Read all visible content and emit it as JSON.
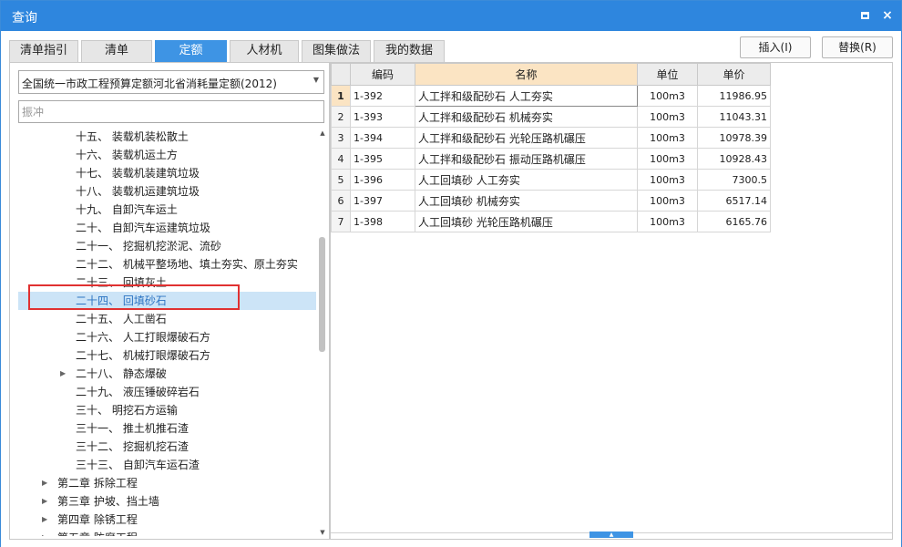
{
  "window": {
    "title": "查询",
    "restore_icon": "restore-icon",
    "close_label": "×"
  },
  "tabs": [
    {
      "label": "清单指引",
      "active": false
    },
    {
      "label": "清单",
      "active": false
    },
    {
      "label": "定额",
      "active": true
    },
    {
      "label": "人材机",
      "active": false
    },
    {
      "label": "图集做法",
      "active": false
    },
    {
      "label": "我的数据",
      "active": false
    }
  ],
  "actions": {
    "insert_label": "插入(I)",
    "replace_label": "替换(R)"
  },
  "left": {
    "quota_library": "全国统一市政工程预算定额河北省消耗量定额(2012)",
    "search_placeholder": "振冲",
    "tree": [
      {
        "label": "十五、  装载机装松散土",
        "level": 2
      },
      {
        "label": "十六、  装载机运土方",
        "level": 2
      },
      {
        "label": "十七、  装载机装建筑垃圾",
        "level": 2
      },
      {
        "label": "十八、  装载机运建筑垃圾",
        "level": 2
      },
      {
        "label": "十九、  自卸汽车运土",
        "level": 2
      },
      {
        "label": "二十、  自卸汽车运建筑垃圾",
        "level": 2
      },
      {
        "label": "二十一、  挖掘机挖淤泥、流砂",
        "level": 2
      },
      {
        "label": "二十二、  机械平整场地、填土夯实、原土夯实",
        "level": 2
      },
      {
        "label": "二十三、  回填灰土",
        "level": 2
      },
      {
        "label": "二十四、  回填砂石",
        "level": 2,
        "selected": true
      },
      {
        "label": "二十五、  人工凿石",
        "level": 2
      },
      {
        "label": "二十六、  人工打眼爆破石方",
        "level": 2
      },
      {
        "label": "二十七、  机械打眼爆破石方",
        "level": 2
      },
      {
        "label": "二十八、  静态爆破",
        "level": 2,
        "expandable": true
      },
      {
        "label": "二十九、  液压锤破碎岩石",
        "level": 2
      },
      {
        "label": "三十、  明挖石方运输",
        "level": 2
      },
      {
        "label": "三十一、  推土机推石渣",
        "level": 2
      },
      {
        "label": "三十二、  挖掘机挖石渣",
        "level": 2
      },
      {
        "label": "三十三、  自卸汽车运石渣",
        "level": 2
      },
      {
        "label": "第二章 拆除工程",
        "level": 1,
        "expandable": true
      },
      {
        "label": "第三章 护坡、挡土墙",
        "level": 1,
        "expandable": true
      },
      {
        "label": "第四章 除锈工程",
        "level": 1,
        "expandable": true
      },
      {
        "label": "第五章 防腐工程",
        "level": 1,
        "expandable": true
      }
    ]
  },
  "grid": {
    "columns": {
      "code": "编码",
      "name": "名称",
      "unit": "单位",
      "price": "单价"
    },
    "rows": [
      {
        "no": "1",
        "code": "1-392",
        "name": "人工拌和级配砂石  人工夯实",
        "unit": "100m3",
        "price": "11986.95"
      },
      {
        "no": "2",
        "code": "1-393",
        "name": "人工拌和级配砂石  机械夯实",
        "unit": "100m3",
        "price": "11043.31"
      },
      {
        "no": "3",
        "code": "1-394",
        "name": "人工拌和级配砂石  光轮压路机碾压",
        "unit": "100m3",
        "price": "10978.39"
      },
      {
        "no": "4",
        "code": "1-395",
        "name": "人工拌和级配砂石  振动压路机碾压",
        "unit": "100m3",
        "price": "10928.43"
      },
      {
        "no": "5",
        "code": "1-396",
        "name": "人工回填砂  人工夯实",
        "unit": "100m3",
        "price": "7300.5"
      },
      {
        "no": "6",
        "code": "1-397",
        "name": "人工回填砂  机械夯实",
        "unit": "100m3",
        "price": "6517.14"
      },
      {
        "no": "7",
        "code": "1-398",
        "name": "人工回填砂  光轮压路机碾压",
        "unit": "100m3",
        "price": "6165.76"
      }
    ]
  },
  "colors": {
    "titlebar": "#2e86de",
    "active_tab": "#3e94e4",
    "selection": "#cce4f7",
    "highlight_box": "#e03131",
    "sorted_header": "#fbe4c3"
  }
}
